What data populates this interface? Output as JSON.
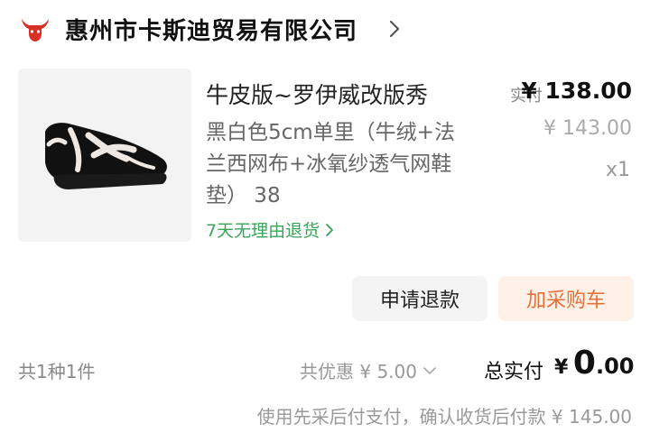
{
  "shop": {
    "logo_icon": "red-bull-head-icon",
    "name": "惠州市卡斯迪贸易有限公司",
    "chevron_icon": "chevron-right-icon"
  },
  "product": {
    "image_alt": "black-white-sneaker-image",
    "title": "牛皮版~罗伊威改版秀",
    "spec": "黑白色5cm单里（牛绒+法兰西网布+冰氧纱透气网鞋垫） 38",
    "return_policy": "7天无理由退货",
    "paid_label": "实付",
    "paid_price": "¥ 138.00",
    "original_price": "¥ 143.00",
    "quantity": "x1"
  },
  "actions": {
    "refund_label": "申请退款",
    "add_to_cart_label": "加采购车"
  },
  "summary": {
    "item_count": "共1种1件",
    "discount": "共优惠 ¥ 5.00",
    "total_label": "总实付",
    "total_currency": "¥",
    "total_integer": "0",
    "total_decimal": ".00",
    "payment_note": "使用先采后付支付，确认收货后付款 ¥ 145.00"
  },
  "colors": {
    "accent_orange": "#e4713a",
    "accent_bg": "#fff1e8",
    "green": "#3aa55a",
    "logo_red": "#d93025"
  }
}
